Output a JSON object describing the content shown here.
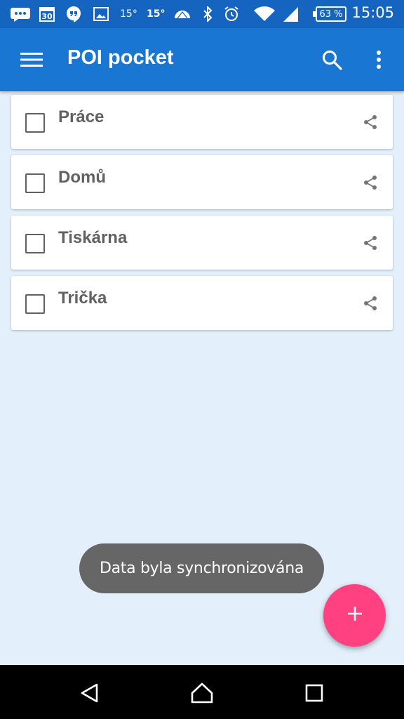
{
  "status_bar": {
    "calendar_day": "30",
    "temp_1": "15°",
    "temp_2": "15°",
    "battery": "63 %",
    "time": "15:05",
    "icons": [
      "chat-bubble-icon",
      "calendar-icon",
      "hangouts-icon",
      "image-icon",
      "weather-icon",
      "bluetooth-icon",
      "alarm-icon",
      "wifi-icon",
      "signal-icon",
      "battery-icon"
    ]
  },
  "app_bar": {
    "title": "POI pocket",
    "icons": [
      "menu-icon",
      "search-icon",
      "more-vert-icon"
    ],
    "color": "#1976d2"
  },
  "items": [
    {
      "label": "Práce",
      "checked": false
    },
    {
      "label": "Domů",
      "checked": false
    },
    {
      "label": "Tiskárna",
      "checked": false
    },
    {
      "label": "Trička",
      "checked": false
    }
  ],
  "toast": {
    "message": "Data byla synchronizována"
  },
  "fab": {
    "icon": "plus-icon",
    "color": "#ff4081"
  },
  "nav_bar": {
    "icons": [
      "back-icon",
      "home-icon",
      "recents-icon"
    ]
  }
}
